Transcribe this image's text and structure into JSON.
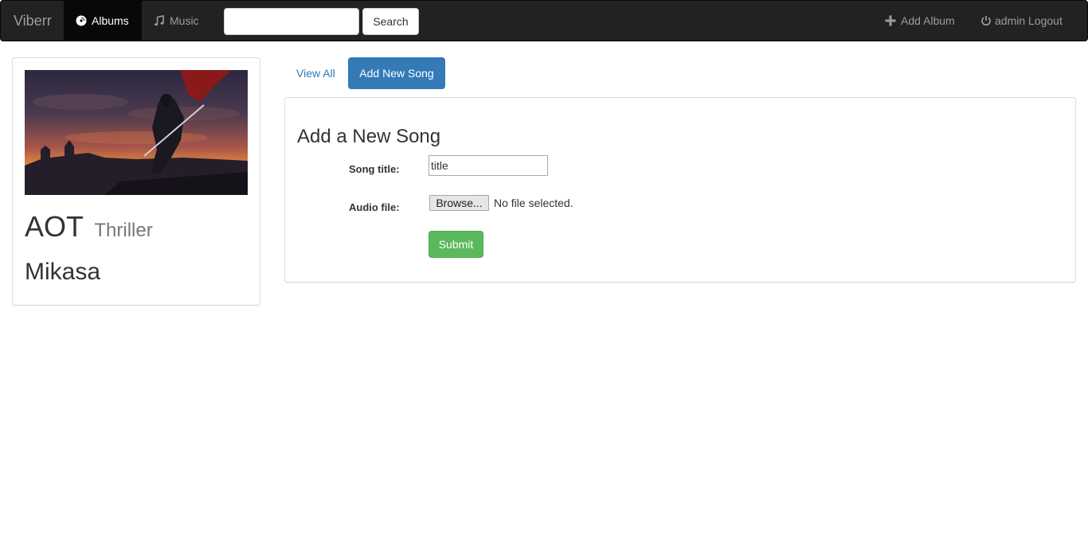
{
  "navbar": {
    "brand": "Viberr",
    "albums_label": "Albums",
    "music_label": "Music",
    "search_placeholder": "",
    "search_button": "Search",
    "add_album_label": "Add Album",
    "logout_label": "admin Logout"
  },
  "album": {
    "title": "AOT",
    "genre": "Thriller",
    "artist": "Mikasa",
    "image_icon": "album-artwork"
  },
  "tabs": {
    "view_all": "View All",
    "add_new_song": "Add New Song"
  },
  "form": {
    "heading": "Add a New Song",
    "song_title_label": "Song title:",
    "song_title_value": "title",
    "audio_file_label": "Audio file:",
    "browse_button": "Browse...",
    "file_status": "No file selected.",
    "submit_button": "Submit"
  },
  "colors": {
    "navbar_bg": "#222222",
    "primary": "#337ab7",
    "success": "#5cb85c"
  }
}
